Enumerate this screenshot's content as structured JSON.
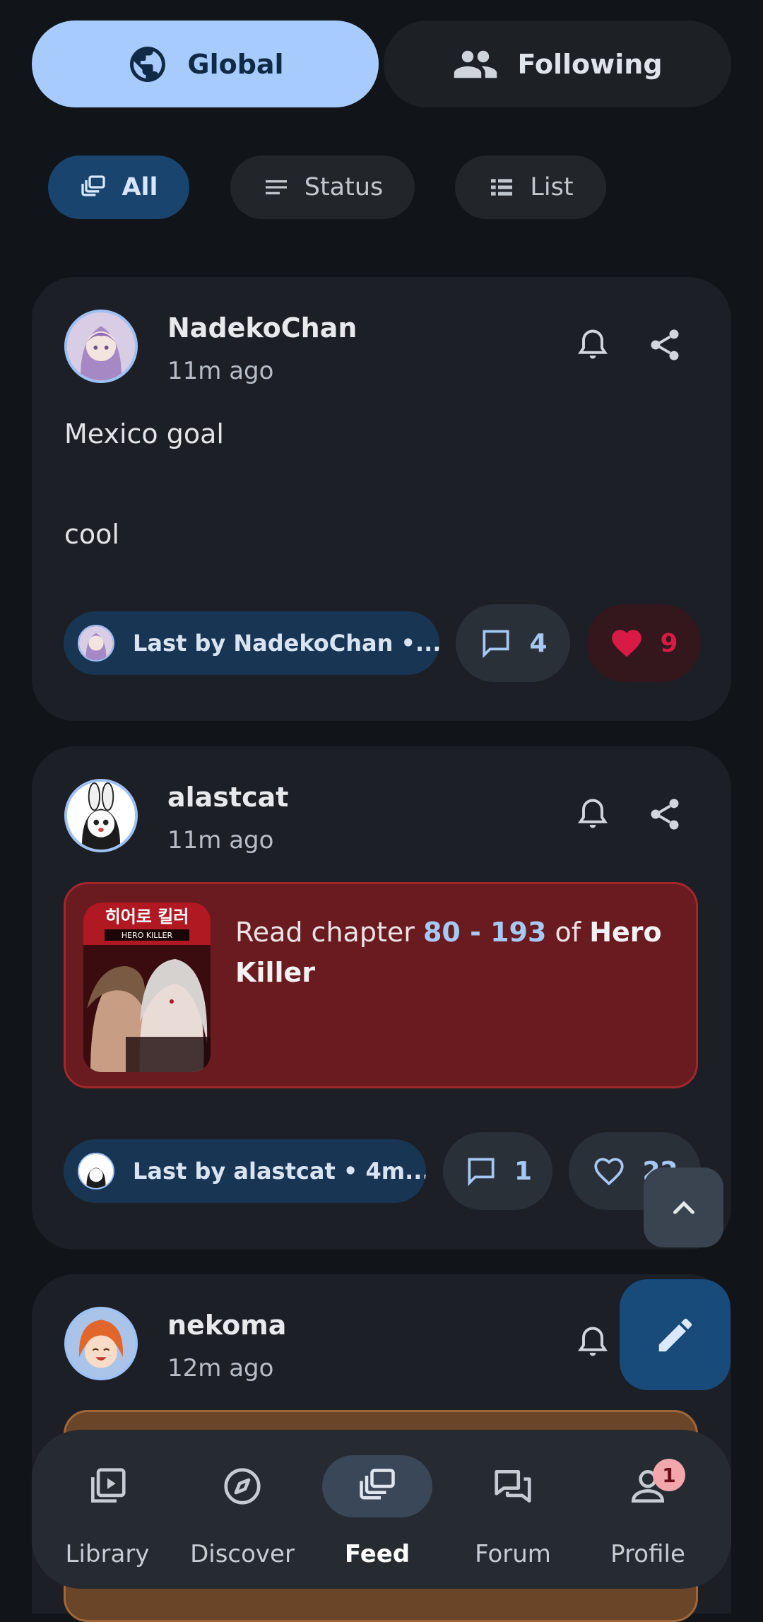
{
  "tabs": {
    "global": "Global",
    "following": "Following"
  },
  "filters": {
    "all": "All",
    "status": "Status",
    "list": "List"
  },
  "posts": [
    {
      "username": "NadekoChan",
      "time": "11m ago",
      "body_lines": [
        "Mexico goal",
        "cool"
      ],
      "last_by": "Last by NadekoChan •...",
      "comments": "4",
      "likes": "9",
      "liked": true
    },
    {
      "username": "alastcat",
      "time": "11m ago",
      "activity": {
        "prefix": "Read chapter",
        "range": "80 - 193",
        "mid": "of",
        "title": "Hero Killer",
        "cover_title_ko": "히어로 킬러",
        "cover_title_en": "HERO KILLER"
      },
      "last_by": "Last by alastcat • 4m...",
      "comments": "1",
      "likes": "22",
      "liked": false
    },
    {
      "username": "nekoma",
      "time": "12m ago"
    }
  ],
  "nav": {
    "items": [
      {
        "label": "Library",
        "icon": "library-icon"
      },
      {
        "label": "Discover",
        "icon": "compass-icon"
      },
      {
        "label": "Feed",
        "icon": "feed-icon"
      },
      {
        "label": "Forum",
        "icon": "forum-icon"
      },
      {
        "label": "Profile",
        "icon": "profile-icon"
      }
    ],
    "active": "Feed",
    "profile_badge": "1"
  },
  "colors": {
    "background": "#111418",
    "accent": "#a6cbfc",
    "like_red": "#d81b45",
    "activity_bg": "#6a1b20"
  }
}
